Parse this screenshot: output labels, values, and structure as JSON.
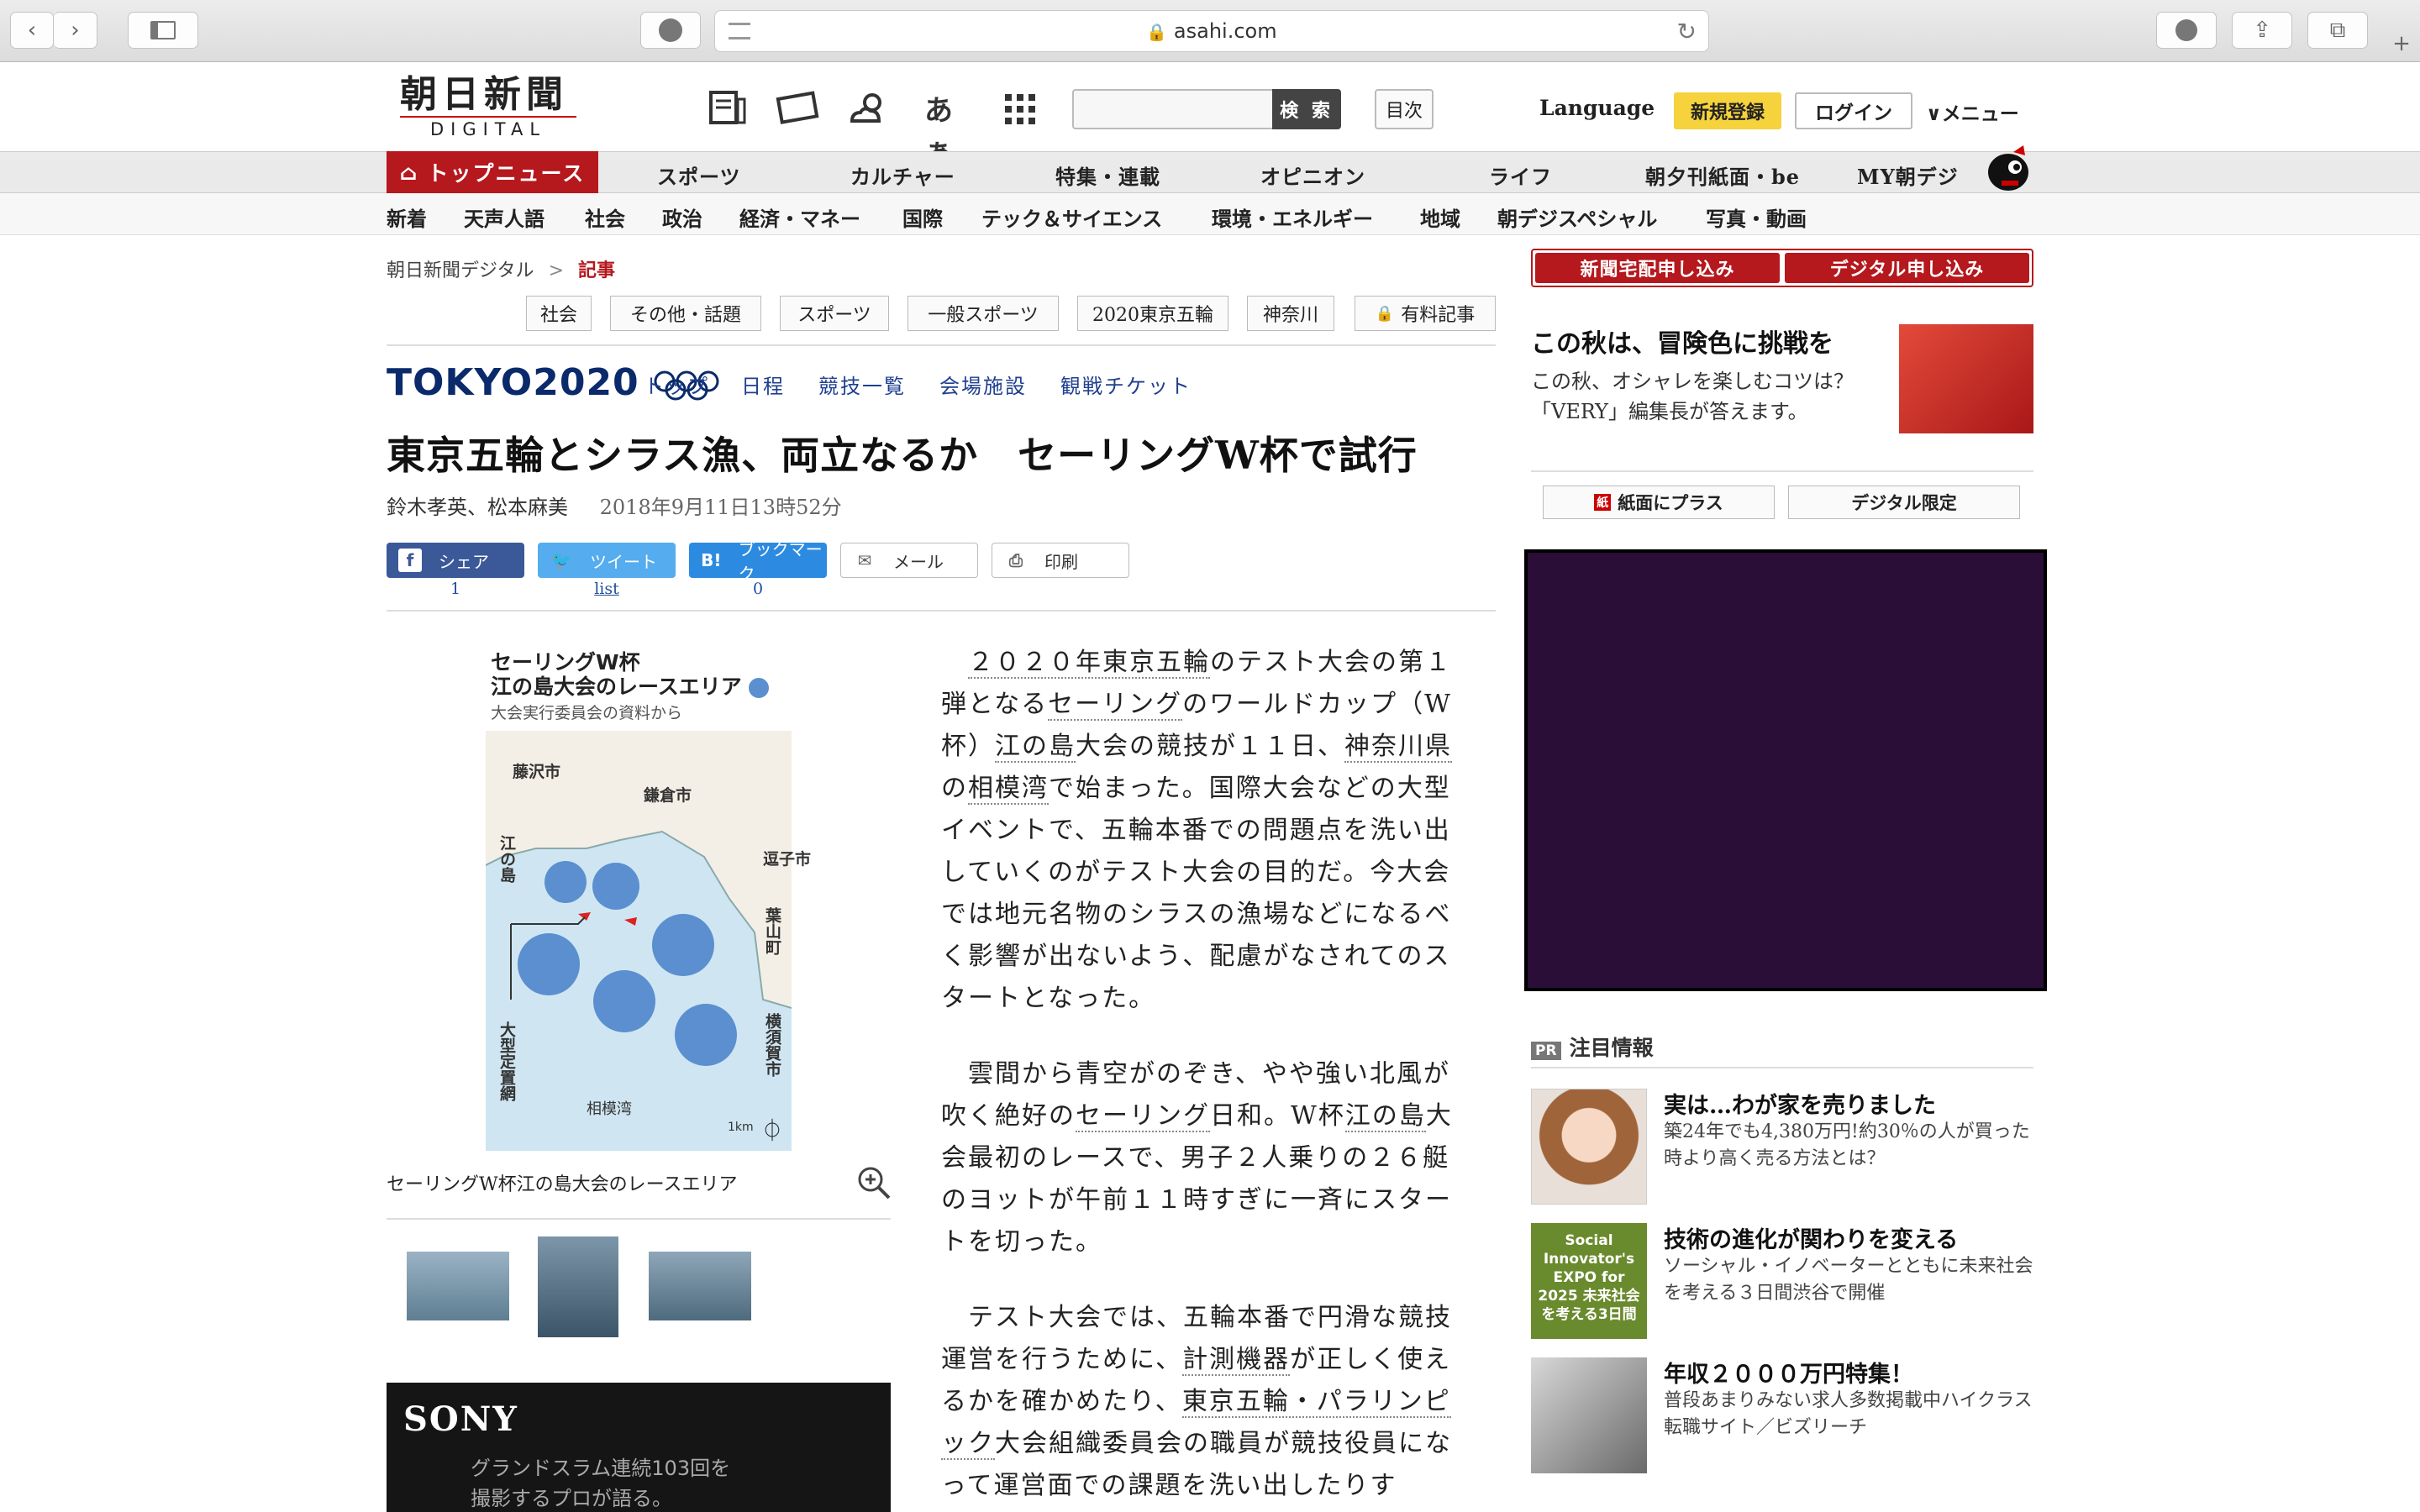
{
  "browser": {
    "url": "asahi.com"
  },
  "header": {
    "logo_kanji": "朝日新聞",
    "logo_sub": "DIGITAL",
    "search_button": "検 索",
    "toc_button": "目次",
    "language": "Language",
    "register": "新規登録",
    "login": "ログイン",
    "menu": "メニュー"
  },
  "nav_main": [
    "トップニュース",
    "スポーツ",
    "カルチャー",
    "特集・連載",
    "オピニオン",
    "ライフ",
    "朝夕刊紙面・be",
    "MY朝デジ"
  ],
  "nav_sub": [
    "新着",
    "天声人語",
    "社会",
    "政治",
    "経済・マネー",
    "国際",
    "テック＆サイエンス",
    "環境・エネルギー",
    "地域",
    "朝デジスペシャル",
    "写真・動画"
  ],
  "breadcrumb": {
    "home": "朝日新聞デジタル",
    "sep": ">",
    "current": "記事"
  },
  "tags": [
    "社会",
    "その他・話題",
    "スポーツ",
    "一般スポーツ",
    "2020東京五輪",
    "神奈川",
    "有料記事"
  ],
  "tokyo2020": {
    "logo": "TOKYO2020",
    "links": [
      "トップ",
      "日程",
      "競技一覧",
      "会場施設",
      "観戦チケット"
    ]
  },
  "article": {
    "headline": "東京五輪とシラス漁、両立なるか　セーリングW杯で試行",
    "authors": "鈴木孝英、松本麻美",
    "date": "2018年9月11日13時52分",
    "share": [
      {
        "label": "シェア",
        "count": "1",
        "icon": "facebook-icon",
        "color": "#3b5998"
      },
      {
        "label": "ツイート",
        "count": "list",
        "icon": "twitter-icon",
        "color": "#55acee"
      },
      {
        "label": "ブックマーク",
        "count": "0",
        "icon": "hatena-bookmark-icon",
        "color": "#2c8be0"
      },
      {
        "label": "メール",
        "count": "",
        "icon": "mail-icon",
        "color": "#ffffff"
      },
      {
        "label": "印刷",
        "count": "",
        "icon": "print-icon",
        "color": "#ffffff"
      }
    ],
    "figure": {
      "title_line1": "セーリングW杯",
      "title_line2": "江の島大会のレースエリア",
      "source": "大会実行委員会の資料から",
      "places": [
        "藤沢市",
        "鎌倉市",
        "江の島",
        "逗子市",
        "葉山町",
        "大型定置網",
        "横須賀市",
        "相模湾",
        "1km"
      ],
      "caption": "セーリングW杯江の島大会のレースエリア"
    },
    "paragraphs": [
      [
        "　",
        "２０２０年東京五輪",
        "のテスト大会の第１弾となる",
        "セーリング",
        "のワールドカップ（W杯）",
        "江の島",
        "大会の競技が１１日、",
        "神奈川県",
        "の",
        "相模湾",
        "で始まった。国際大会などの大型イベントで、五輪本番での問題点を洗い出していくのがテスト大会の目的だ。今大会では地元名物のシラスの漁場などになるべく影響が出ないよう、配慮がなされてのスタートとなった。"
      ],
      [
        "　雲間から青空がのぞき、やや強い北風が吹く絶好の",
        "セーリング",
        "日和。W杯",
        "江の島",
        "大会最初のレースで、男子２人乗りの２６艇のヨットが午前１１時すぎに一斉にスタートを切った。"
      ],
      [
        "　テスト大会では、五輪本番で円滑な競技運営を行うために、",
        "計測機器",
        "が正しく使えるかを確かめたり、",
        "東京五輪・パラリンピック",
        "大会組織委員会の職員が競技役員になって運営面での課題を洗い出したりす"
      ]
    ]
  },
  "ad_sony": {
    "brand": "SONY",
    "line1": "グランドスラム連続103回を",
    "line2": "撮影するプロが語る。"
  },
  "sidebar": {
    "subscribe_paper": "新聞宅配申し込み",
    "subscribe_digital": "デジタル申し込み",
    "promo_title": "この秋は、冒険色に挑戦を",
    "promo_text": "この秋、オシャレを楽しむコツは？　「VERY」編集長が答えます。",
    "btn_paper_plus": "紙面にプラス",
    "btn_digital_only": "デジタル限定",
    "pr_label": "PR",
    "pr_heading": "注目情報",
    "pr_items": [
      {
        "title": "実は…わが家を売りました",
        "desc": "築24年でも4,380万円!約30％の人が買った時より高く売る方法とは？"
      },
      {
        "title": "技術の進化が関わりを変える",
        "desc": "ソーシャル・イノベーターとともに未来社会を考える３日間渋谷で開催",
        "img_text": "Social Innovator's EXPO for 2025 未来社会を考える3日間"
      },
      {
        "title": "年収２０００万円特集！",
        "desc": "普段あまりみない求人多数掲載中ハイクラス転職サイト／ビズリーチ"
      }
    ]
  }
}
